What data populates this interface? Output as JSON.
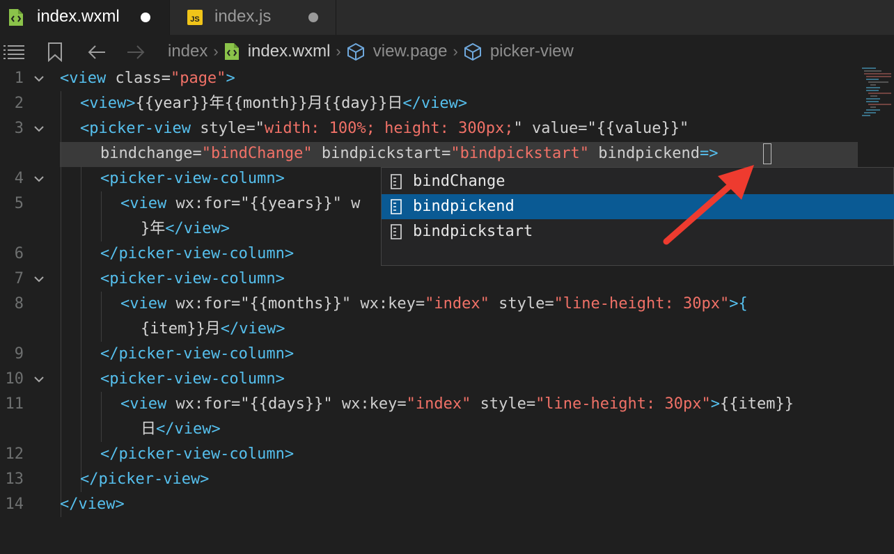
{
  "tabs": [
    {
      "label": "index.wxml",
      "icon": "wxml-file-icon",
      "active": true,
      "dirty": true
    },
    {
      "label": "index.js",
      "icon": "js-file-icon",
      "active": false,
      "dirty": true
    }
  ],
  "toolbar": {
    "breadcrumb": {
      "root": "index",
      "file": "index.wxml",
      "node1": "view.page",
      "node2": "picker-view"
    }
  },
  "editor": {
    "line_numbers": [
      "1",
      "2",
      "3",
      "4",
      "5",
      "6",
      "7",
      "8",
      "9",
      "10",
      "11",
      "12",
      "13",
      "14"
    ]
  },
  "code": {
    "l1": {
      "t1": "<view",
      "a1": " class=",
      "s1": "\"page\"",
      "t2": ">"
    },
    "l2": {
      "t1": "<view>",
      "x1": "{{year}}年{{month}}月{{day}}日",
      "t2": "</view>"
    },
    "l3": {
      "t1": "<picker-view",
      "a1": " style=",
      "q1": "\"",
      "s1": "width: 100%; height: 300px;",
      "q2": "\"",
      "a2": " value=",
      "s2": "\"{{value}}\""
    },
    "l3b": {
      "a1": "bindchange=",
      "s1": "\"bindChange\"",
      "a2": " bindpickstart=",
      "s2": "\"bindpickstart\"",
      "a3": " bindpickend",
      "t1": "=>"
    },
    "l4": {
      "t1": "<picker-view-column>"
    },
    "l5": {
      "t1": "<view",
      "a1": " wx:for=",
      "s1": "\"{{years}}\"",
      "a2": " w"
    },
    "l5b": {
      "x1": "}年",
      "t1": "</view>"
    },
    "l6": {
      "t1": "</picker-view-column>"
    },
    "l7": {
      "t1": "<picker-view-column>"
    },
    "l8": {
      "t1": "<view",
      "a1": " wx:for=",
      "s1": "\"{{months}}\"",
      "a2": " wx:key=",
      "s2": "\"index\"",
      "a3": " style=",
      "s3": "\"line-height: 30px\"",
      "t2": ">{"
    },
    "l8b": {
      "x1": "{item}}月",
      "t1": "</view>"
    },
    "l9": {
      "t1": "</picker-view-column>"
    },
    "l10": {
      "t1": "<picker-view-column>"
    },
    "l11": {
      "t1": "<view",
      "a1": " wx:for=",
      "s1": "\"{{days}}\"",
      "a2": " wx:key=",
      "s2": "\"index\"",
      "a3": " style=",
      "s3": "\"line-height: 30px\"",
      "t2": ">",
      "x1": "{{item}}"
    },
    "l11b": {
      "x1": "日",
      "t1": "</view>"
    },
    "l12": {
      "t1": "</picker-view-column>"
    },
    "l13": {
      "t1": "</picker-view>"
    },
    "l14": {
      "t1": "</view>"
    }
  },
  "autocomplete": {
    "items": [
      {
        "label": "bindChange",
        "selected": false
      },
      {
        "label": "bindpickend",
        "selected": true
      },
      {
        "label": "bindpickstart",
        "selected": false
      }
    ]
  },
  "colors": {
    "tag": "#56c0ee",
    "string": "#f07167",
    "attribute": "#cfcfcf",
    "annotation_arrow": "#ee3b2f",
    "selection": "#0a5a94"
  }
}
